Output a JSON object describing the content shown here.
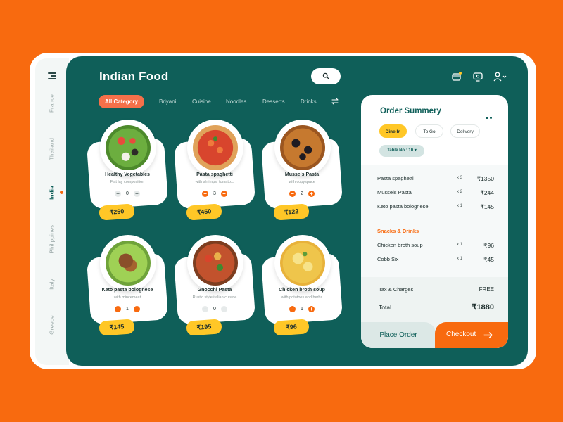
{
  "app": {
    "title": "Indian Food"
  },
  "sidebar": {
    "countries": [
      "France",
      "Thailand",
      "India",
      "Philippines",
      "Italy",
      "Greece"
    ],
    "active": "India"
  },
  "categories": {
    "items": [
      "All Category",
      "Briyani",
      "Cuisine",
      "Noodles",
      "Desserts",
      "Drinks"
    ],
    "active": "All Category"
  },
  "dishes": [
    {
      "name": "Healthy Vegetables",
      "desc": "Flat lay composition",
      "qty": "0",
      "price": "₹260"
    },
    {
      "name": "Pasta spaghetti",
      "desc": "with shrimps, tomato...",
      "qty": "3",
      "price": "₹450"
    },
    {
      "name": "Mussels Pasta",
      "desc": "with copyspace",
      "qty": "2",
      "price": "₹122"
    },
    {
      "name": "Keto pasta bolognese",
      "desc": "with mincemeat",
      "qty": "1",
      "price": "₹145"
    },
    {
      "name": "Gnocchi Pasta",
      "desc": "Rustic style italian cuisine",
      "qty": "0",
      "price": "₹195"
    },
    {
      "name": "Chicken broth soup",
      "desc": "with potatoes and herbs",
      "qty": "1",
      "price": "₹96"
    }
  ],
  "order": {
    "title": "Order Summery",
    "types": [
      "Dine In",
      "To Go",
      "Delivery"
    ],
    "active_type": "Dine In",
    "table": "Table No : 10",
    "items": [
      {
        "name": "Pasta spaghetti",
        "qty": "x 3",
        "price": "₹1350"
      },
      {
        "name": "Mussels Pasta",
        "qty": "x 2",
        "price": "₹244"
      },
      {
        "name": "Keto pasta bolognese",
        "qty": "x 1",
        "price": "₹145"
      }
    ],
    "snacks_label": "Snacks & Drinks",
    "snacks": [
      {
        "name": "Chicken broth soup",
        "qty": "x 1",
        "price": "₹96"
      },
      {
        "name": "Cobb Six",
        "qty": "x 1",
        "price": "₹45"
      }
    ],
    "tax_label": "Tax & Charges",
    "tax_value": "FREE",
    "total_label": "Total",
    "total_value": "₹1880",
    "place_label": "Place Order",
    "checkout_label": "Checkout"
  },
  "colors": {
    "background": "#f86a0f",
    "panel": "#0f5f59",
    "accent_yellow": "#ffc727",
    "accent_orange": "#f86a0f"
  },
  "icons": [
    "menu-icon",
    "search-icon",
    "wallet-icon",
    "monitor-icon",
    "user-icon",
    "filter-icon",
    "arrow-right-icon"
  ]
}
